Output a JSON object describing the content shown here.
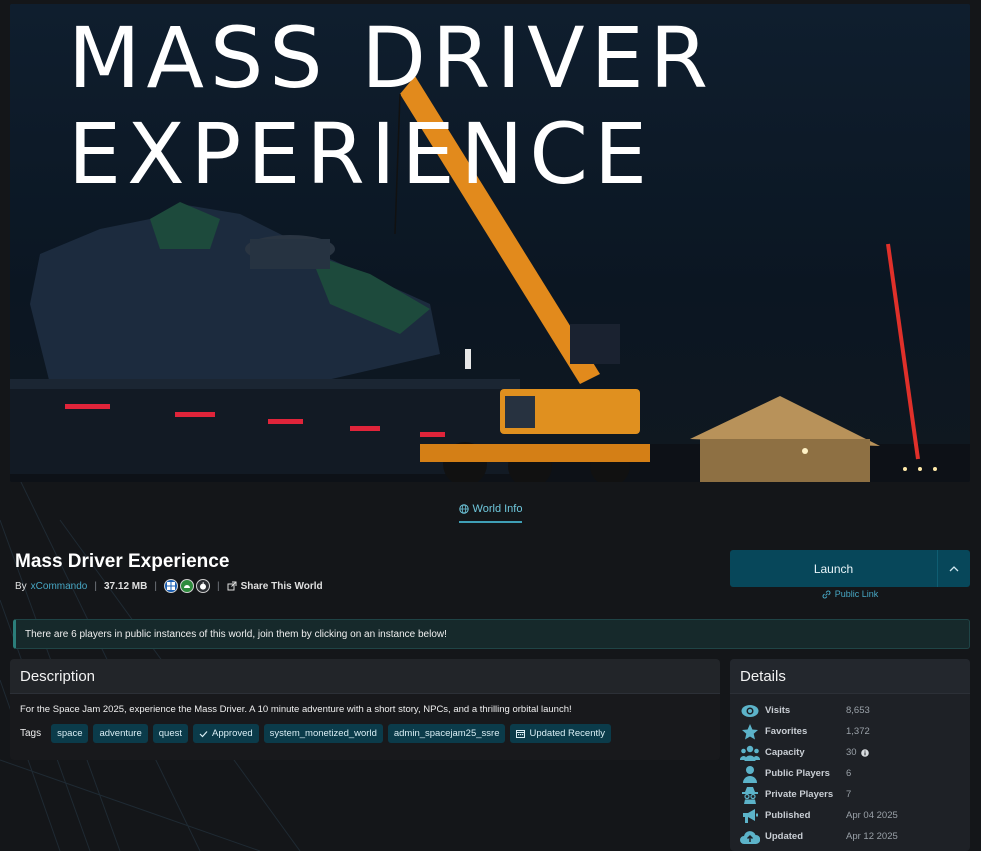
{
  "hero": {
    "title_line1": "MASS DRIVER",
    "title_line2": "EXPERIENCE"
  },
  "tabs": [
    {
      "label": "World Info",
      "icon": "globe-icon",
      "active": true
    }
  ],
  "world": {
    "name": "Mass Driver Experience",
    "by_label": "By",
    "author": "xCommando",
    "size": "37.12 MB",
    "platforms": [
      "windows-icon",
      "android-icon",
      "apple-icon"
    ],
    "share_label": "Share This World"
  },
  "launch": {
    "label": "Launch",
    "public_link": "Public Link"
  },
  "notice": "There are 6 players in public instances of this world, join them by clicking on an instance below!",
  "description": {
    "header": "Description",
    "text": "For the Space Jam 2025, experience the Mass Driver. A 10 minute adventure with a short story, NPCs, and a thrilling orbital launch!",
    "tags_label": "Tags",
    "tags": [
      {
        "label": "space",
        "icon": ""
      },
      {
        "label": "adventure",
        "icon": ""
      },
      {
        "label": "quest",
        "icon": ""
      },
      {
        "label": "Approved",
        "icon": "check-icon"
      },
      {
        "label": "system_monetized_world",
        "icon": ""
      },
      {
        "label": "admin_spacejam25_ssre",
        "icon": ""
      },
      {
        "label": "Updated Recently",
        "icon": "calendar-icon"
      }
    ]
  },
  "details": {
    "header": "Details",
    "rows": [
      {
        "label": "Visits",
        "value": "8,653",
        "icon": "eye-icon"
      },
      {
        "label": "Favorites",
        "value": "1,372",
        "icon": "star-icon"
      },
      {
        "label": "Capacity",
        "value": "30",
        "icon": "group-icon",
        "info": true
      },
      {
        "label": "Public Players",
        "value": "6",
        "icon": "person-icon"
      },
      {
        "label": "Private Players",
        "value": "7",
        "icon": "incognito-icon"
      },
      {
        "label": "Published",
        "value": "Apr 04 2025",
        "icon": "megaphone-icon"
      },
      {
        "label": "Updated",
        "value": "Apr 12 2025",
        "icon": "cloud-upload-icon"
      }
    ]
  },
  "colors": {
    "accent": "#47a7c4",
    "launch_bg": "#07475a",
    "tag_bg": "#0b3b4a",
    "notice_bg": "#16292b",
    "icon": "#5cb3c9"
  }
}
